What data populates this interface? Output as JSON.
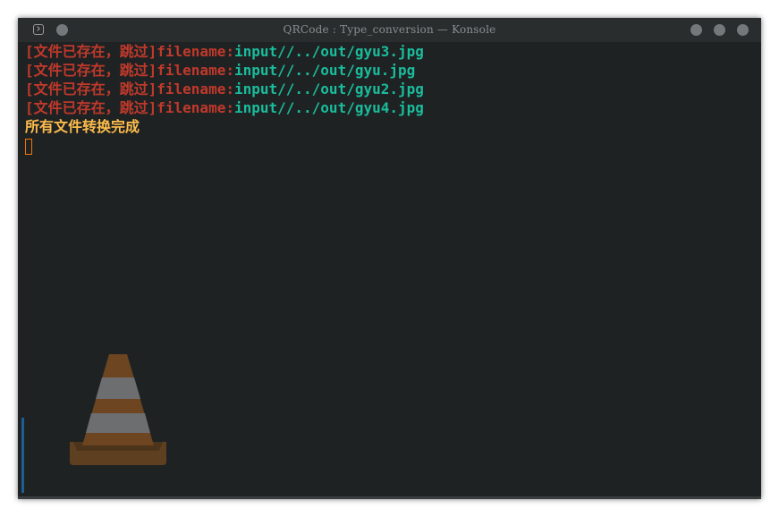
{
  "window": {
    "title": "QRCode : Type_conversion — Konsole"
  },
  "icons": {
    "app": "terminal-app-icon",
    "pin": "pin-icon",
    "minimize": "minimize-icon",
    "maximize": "maximize-icon",
    "close": "close-icon",
    "watermark": "vlc-cone-icon"
  },
  "terminal": {
    "lines": [
      {
        "prefix": "[文件已存在，跳过]filename:",
        "path": "input//../out/gyu3.jpg"
      },
      {
        "prefix": "[文件已存在，跳过]filename:",
        "path": "input//../out/gyu.jpg"
      },
      {
        "prefix": "[文件已存在，跳过]filename:",
        "path": "input//../out/gyu2.jpg"
      },
      {
        "prefix": "[文件已存在，跳过]filename:",
        "path": "input//../out/gyu4.jpg"
      }
    ],
    "done_message": "所有文件转换完成"
  },
  "colors": {
    "background": "#1f2223",
    "error": "#c0392b",
    "path": "#1abc9c",
    "message": "#fdbc4b",
    "cursor": "#f67400"
  }
}
